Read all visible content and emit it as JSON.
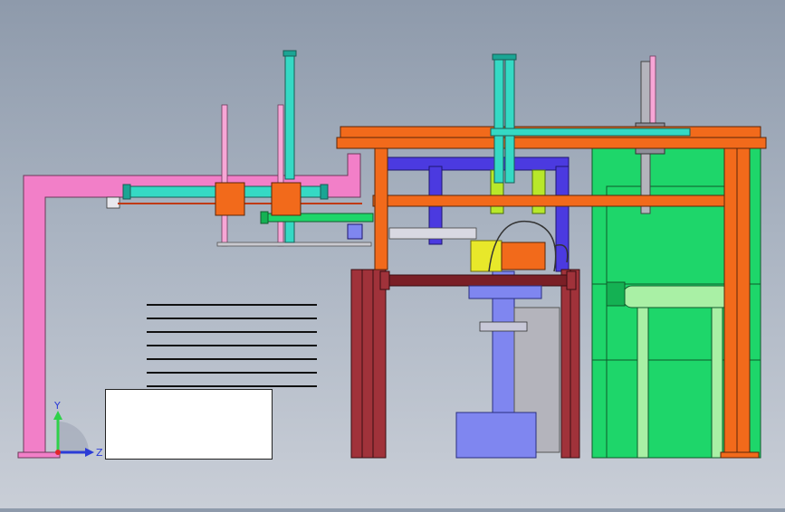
{
  "viewport": {
    "background_top": "#8e9aab",
    "background_bottom": "#c9ced7"
  },
  "colors": {
    "pink": "#f27fc8",
    "pink_light": "#f7a6d6",
    "orange": "#f26a1b",
    "orange_dark": "#d45510",
    "cyan": "#35d9c4",
    "cyan_dark": "#1aa594",
    "blue": "#4b3ae0",
    "blue_light": "#7f86f0",
    "green": "#1ed66a",
    "green_dark": "#14b153",
    "green_light": "#a9f0a5",
    "maroon": "#a0323a",
    "maroon_dark": "#7a1f26",
    "yellow": "#e8e82a",
    "lime": "#b8e82a",
    "grey": "#b4b4bc",
    "grey_dark": "#8e8e98"
  },
  "coordinate_triad": {
    "y_label": "Y",
    "z_label": "Z",
    "y_color": "#2fd14a",
    "z_color": "#2b3bd6",
    "x_color": "#e0262b"
  },
  "icons": {
    "triad": "coordinate-axes-icon"
  }
}
